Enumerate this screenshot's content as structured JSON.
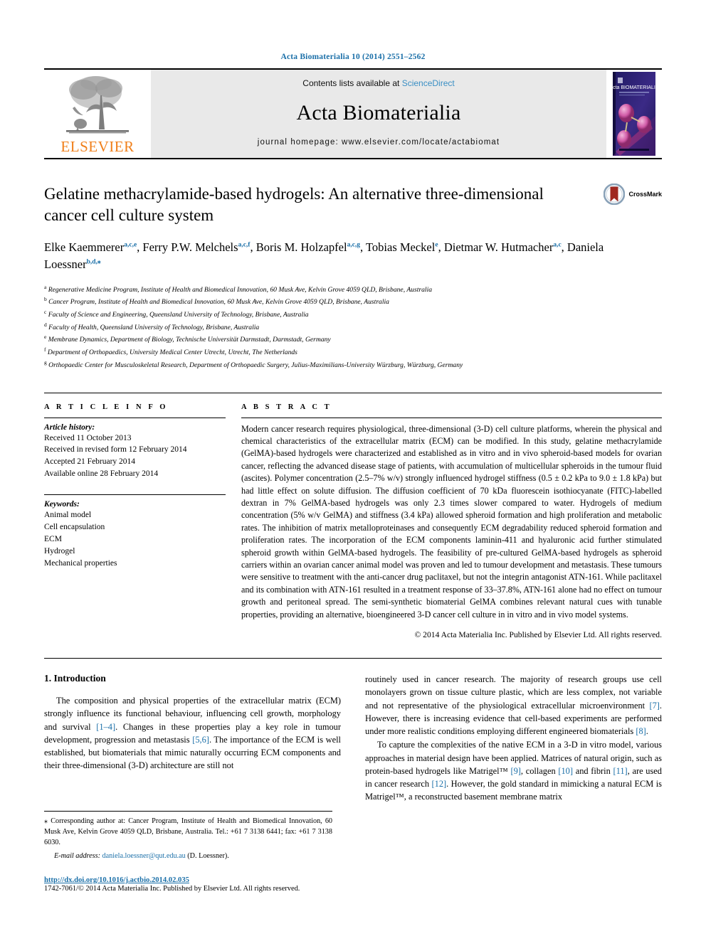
{
  "journal_ref": "Acta Biomaterialia 10 (2014) 2551–2562",
  "masthead": {
    "contents_prefix": "Contents lists available at ",
    "sciencedirect": "ScienceDirect",
    "journal_title": "Acta Biomaterialia",
    "homepage": "journal homepage: www.elsevier.com/locate/actabiomat",
    "publisher": "ELSEVIER",
    "cover_title": "Acta BIOMATERIALIA"
  },
  "article": {
    "title": "Gelatine methacrylamide-based hydrogels: An alternative three-dimensional cancer cell culture system",
    "crossmark_label": "CrossMark",
    "authors": [
      {
        "name": "Elke Kaemmerer",
        "sup": "a,c,e",
        "sep": ", "
      },
      {
        "name": "Ferry P.W. Melchels",
        "sup": "a,c,f",
        "sep": ", "
      },
      {
        "name": "Boris M. Holzapfel",
        "sup": "a,c,g",
        "sep": ", "
      },
      {
        "name": "Tobias Meckel",
        "sup": "e",
        "sep": ", "
      },
      {
        "name": "Dietmar W. Hutmacher",
        "sup": "a,c",
        "sep": ", "
      },
      {
        "name": "Daniela Loessner",
        "sup": "b,d,",
        "star": "⁎",
        "sep": ""
      }
    ],
    "affiliations": [
      {
        "mark": "a",
        "text": "Regenerative Medicine Program, Institute of Health and Biomedical Innovation, 60 Musk Ave, Kelvin Grove 4059 QLD, Brisbane, Australia"
      },
      {
        "mark": "b",
        "text": "Cancer Program, Institute of Health and Biomedical Innovation, 60 Musk Ave, Kelvin Grove 4059 QLD, Brisbane, Australia"
      },
      {
        "mark": "c",
        "text": "Faculty of Science and Engineering, Queensland University of Technology, Brisbane, Australia"
      },
      {
        "mark": "d",
        "text": "Faculty of Health, Queensland University of Technology, Brisbane, Australia"
      },
      {
        "mark": "e",
        "text": "Membrane Dynamics, Department of Biology, Technische Universität Darmstadt, Darmstadt, Germany"
      },
      {
        "mark": "f",
        "text": "Department of Orthopaedics, University Medical Center Utrecht, Utrecht, The Netherlands"
      },
      {
        "mark": "g",
        "text": "Orthopaedic Center for Musculoskeletal Research, Department of Orthopaedic Surgery, Julius-Maximilians-University Würzburg, Würzburg, Germany"
      }
    ]
  },
  "article_info": {
    "heading": "A R T I C L E   I N F O",
    "history_label": "Article history:",
    "history": [
      "Received 11 October 2013",
      "Received in revised form 12 February 2014",
      "Accepted 21 February 2014",
      "Available online 28 February 2014"
    ],
    "keywords_label": "Keywords:",
    "keywords": [
      "Animal model",
      "Cell encapsulation",
      "ECM",
      "Hydrogel",
      "Mechanical properties"
    ]
  },
  "abstract": {
    "heading": "A B S T R A C T",
    "text": "Modern cancer research requires physiological, three-dimensional (3-D) cell culture platforms, wherein the physical and chemical characteristics of the extracellular matrix (ECM) can be modified. In this study, gelatine methacrylamide (GelMA)-based hydrogels were characterized and established as in vitro and in vivo spheroid-based models for ovarian cancer, reflecting the advanced disease stage of patients, with accumulation of multicellular spheroids in the tumour fluid (ascites). Polymer concentration (2.5–7% w/v) strongly influenced hydrogel stiffness (0.5 ± 0.2 kPa to 9.0 ± 1.8 kPa) but had little effect on solute diffusion. The diffusion coefficient of 70 kDa fluorescein isothiocyanate (FITC)-labelled dextran in 7% GelMA-based hydrogels was only 2.3 times slower compared to water. Hydrogels of medium concentration (5% w/v GelMA) and stiffness (3.4 kPa) allowed spheroid formation and high proliferation and metabolic rates. The inhibition of matrix metalloproteinases and consequently ECM degradability reduced spheroid formation and proliferation rates. The incorporation of the ECM components laminin-411 and hyaluronic acid further stimulated spheroid growth within GelMA-based hydrogels. The feasibility of pre-cultured GelMA-based hydrogels as spheroid carriers within an ovarian cancer animal model was proven and led to tumour development and metastasis. These tumours were sensitive to treatment with the anti-cancer drug paclitaxel, but not the integrin antagonist ATN-161. While paclitaxel and its combination with ATN-161 resulted in a treatment response of 33–37.8%, ATN-161 alone had no effect on tumour growth and peritoneal spread. The semi-synthetic biomaterial GelMA combines relevant natural cues with tunable properties, providing an alternative, bioengineered 3-D cancer cell culture in in vitro and in vivo model systems.",
    "copyright": "© 2014 Acta Materialia Inc. Published by Elsevier Ltd. All rights reserved."
  },
  "introduction": {
    "section_title": "1. Introduction",
    "left_paragraph_parts": [
      {
        "t": "The composition and physical properties of the extracellular matrix (ECM) strongly influence its functional behaviour, influencing cell growth, morphology and survival "
      },
      {
        "t": "[1–4]",
        "cite": true
      },
      {
        "t": ". Changes in these properties play a key role in tumour development, progression and metastasis "
      },
      {
        "t": "[5,6]",
        "cite": true
      },
      {
        "t": ". The importance of the ECM is well established, but biomaterials that mimic naturally occurring ECM components and their three-dimensional (3-D) architecture are still not"
      }
    ],
    "right_paragraph1_parts": [
      {
        "t": "routinely used in cancer research. The majority of research groups use cell monolayers grown on tissue culture plastic, which are less complex, not variable and not representative of the physiological extracellular microenvironment "
      },
      {
        "t": "[7]",
        "cite": true
      },
      {
        "t": ". However, there is increasing evidence that cell-based experiments are performed under more realistic conditions employing different engineered biomaterials "
      },
      {
        "t": "[8]",
        "cite": true
      },
      {
        "t": "."
      }
    ],
    "right_paragraph2_parts": [
      {
        "t": "To capture the complexities of the native ECM in a 3-D in vitro model, various approaches in material design have been applied. Matrices of natural origin, such as protein-based hydrogels like Matrigel™ "
      },
      {
        "t": "[9]",
        "cite": true
      },
      {
        "t": ", collagen "
      },
      {
        "t": "[10]",
        "cite": true
      },
      {
        "t": " and fibrin "
      },
      {
        "t": "[11]",
        "cite": true
      },
      {
        "t": ", are used in cancer research "
      },
      {
        "t": "[12]",
        "cite": true
      },
      {
        "t": ". However, the gold standard in mimicking a natural ECM is Matrigel™, a reconstructed basement membrane matrix"
      }
    ]
  },
  "footnotes": {
    "corresponding": "Corresponding author at: Cancer Program, Institute of Health and Biomedical Innovation, 60 Musk Ave, Kelvin Grove 4059 QLD, Brisbane, Australia. Tel.: +61 7 3138 6441; fax: +61 7 3138 6030.",
    "email_label": "E-mail address:",
    "email": "daniela.loessner@qut.edu.au",
    "email_suffix": "(D. Loessner).",
    "doi": "http://dx.doi.org/10.1016/j.actbio.2014.02.035",
    "issn": "1742-7061/© 2014 Acta Materialia Inc. Published by Elsevier Ltd. All rights reserved."
  },
  "colors": {
    "link": "#1a6fa8",
    "elsevier_orange": "#f07f1a",
    "band_grey": "#e9e9e9",
    "crossmark_red": "#a02820"
  }
}
